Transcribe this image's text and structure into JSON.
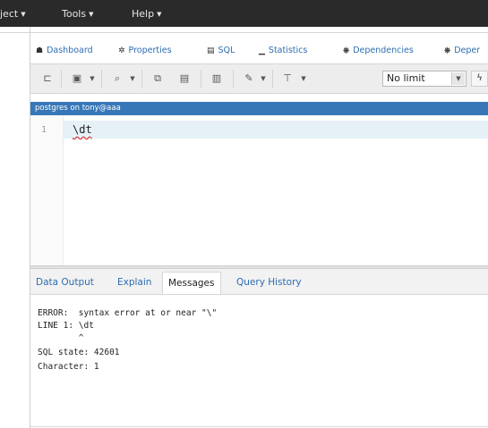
{
  "menubar": {
    "items": [
      {
        "label": "ject"
      },
      {
        "label": "Tools"
      },
      {
        "label": "Help"
      }
    ]
  },
  "tabs": [
    {
      "icon": "dashboard-icon",
      "glyph": "☗",
      "label": "Dashboard"
    },
    {
      "icon": "properties-icon",
      "glyph": "✲",
      "label": "Properties"
    },
    {
      "icon": "sql-icon",
      "glyph": "▤",
      "label": "SQL"
    },
    {
      "icon": "statistics-icon",
      "glyph": "▁",
      "label": "Statistics"
    },
    {
      "icon": "dependencies-icon",
      "glyph": "⎈",
      "label": "Dependencies"
    },
    {
      "icon": "dependents-icon",
      "glyph": "⎈",
      "label": "Deper"
    }
  ],
  "toolbar": {
    "limit_value": "No limit"
  },
  "connection": {
    "label": "postgres on tony@aaa"
  },
  "editor": {
    "line_number": "1",
    "code": "\\dt"
  },
  "results": {
    "tabs": [
      {
        "label": "Data Output"
      },
      {
        "label": "Explain"
      },
      {
        "label": "Messages",
        "active": true
      },
      {
        "label": "Query History"
      }
    ],
    "messages": [
      "ERROR:  syntax error at or near \"\\\"",
      "LINE 1: \\dt",
      "        ^",
      "SQL state: 42601",
      "Character: 1"
    ]
  },
  "colors": {
    "menubar_bg": "#2a2a2a",
    "connection_bg": "#3777b8",
    "tab_text": "#2c6cb2"
  }
}
